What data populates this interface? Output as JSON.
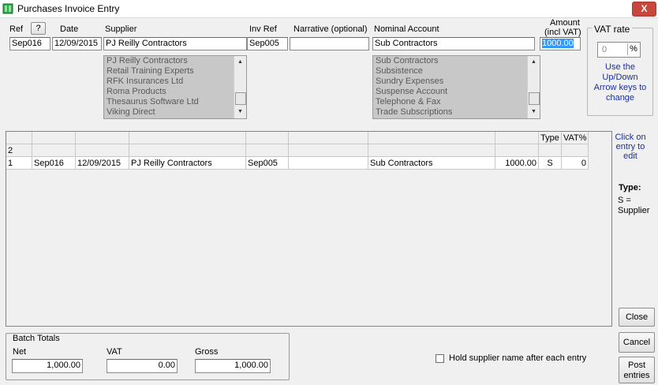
{
  "window": {
    "title": "Purchases Invoice Entry",
    "close_glyph": "X"
  },
  "header_labels": {
    "ref": "Ref",
    "help": "?",
    "date": "Date",
    "supplier": "Supplier",
    "inv_ref": "Inv Ref",
    "narrative": "Narrative (optional)",
    "nominal": "Nominal Account",
    "amount_line1": "Amount",
    "amount_line2": "(incl VAT)"
  },
  "fields": {
    "ref": "Sep016",
    "date": "12/09/2015",
    "supplier": "PJ Reilly Contractors",
    "inv_ref": "Sep005",
    "narrative": "",
    "nominal": "Sub Contractors",
    "amount": "1000.00"
  },
  "supplier_list": [
    "PJ Reilly Contractors",
    "Retail Training Experts",
    "RFK Insurances Ltd",
    "Roma Products",
    "Thesaurus Software Ltd",
    "Viking Direct"
  ],
  "nominal_list": [
    "Sub Contractors",
    "Subsistence",
    "Sundry Expenses",
    "Suspense Account",
    "Telephone & Fax",
    "Trade Subscriptions"
  ],
  "vat": {
    "title": "VAT rate",
    "value": "0",
    "percent": "%",
    "hint": "Use the Up/Down Arrow keys to change"
  },
  "grid": {
    "headers": [
      "",
      "",
      "",
      "",
      "",
      "",
      "",
      "",
      "Type",
      "VAT%"
    ],
    "rows": [
      [
        "2",
        "",
        "",
        "",
        "",
        "",
        "",
        "",
        "",
        ""
      ],
      [
        "1",
        "Sep016",
        "12/09/2015",
        "PJ Reilly Contractors",
        "Sep005",
        "",
        "Sub Contractors",
        "1000.00",
        "S",
        "0"
      ]
    ]
  },
  "side_panel": {
    "click_hint": "Click on entry to edit",
    "type_label": "Type:",
    "type_desc": "S = Supplier"
  },
  "batch": {
    "title": "Batch Totals",
    "net_label": "Net",
    "vat_label": "VAT",
    "gross_label": "Gross",
    "net": "1,000.00",
    "vat": "0.00",
    "gross": "1,000.00"
  },
  "hold_checkbox": {
    "label": "Hold supplier name after each entry",
    "checked": false
  },
  "buttons": {
    "close": "Close",
    "cancel": "Cancel",
    "post": "Post entries"
  },
  "colors": {
    "accent_blue": "#1b2fa0",
    "selection": "#3399ff",
    "close_red": "#c7473d"
  },
  "icons": {
    "app": "green-ledger-icon",
    "close": "close-icon"
  }
}
